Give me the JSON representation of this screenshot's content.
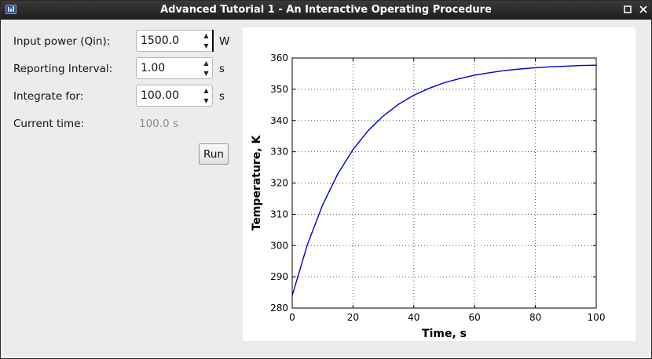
{
  "window": {
    "title": "Advanced Tutorial 1 - An Interactive Operating Procedure"
  },
  "icons": {
    "app": "app-logo-icon",
    "maximize": "maximize-icon",
    "close": "close-icon",
    "spin_up": "triangle-up-icon",
    "spin_down": "triangle-down-icon"
  },
  "form": {
    "input_power": {
      "label": "Input power (Qin):",
      "value": "1500.0",
      "unit": "W"
    },
    "reporting_interval": {
      "label": "Reporting Interval:",
      "value": "1.00",
      "unit": "s"
    },
    "integrate_for": {
      "label": "Integrate for:",
      "value": "100.00",
      "unit": "s"
    },
    "current_time": {
      "label": "Current time:",
      "value": "100.0 s"
    },
    "run_label": "Run"
  },
  "chart_data": {
    "type": "line",
    "title": "",
    "xlabel": "Time, s",
    "ylabel": "Temperature, K",
    "xlim": [
      0,
      100
    ],
    "ylim": [
      280,
      360
    ],
    "xticks": [
      0,
      20,
      40,
      60,
      80,
      100
    ],
    "yticks": [
      280,
      290,
      300,
      310,
      320,
      330,
      340,
      350,
      360
    ],
    "grid": true,
    "series": [
      {
        "color": "#0000cc",
        "x": [
          0,
          5,
          10,
          15,
          20,
          25,
          30,
          35,
          40,
          45,
          50,
          55,
          60,
          65,
          70,
          75,
          80,
          85,
          90,
          95,
          100
        ],
        "y": [
          284,
          300.3,
          313.0,
          322.9,
          330.7,
          336.8,
          341.5,
          345.2,
          348.1,
          350.3,
          352.1,
          353.4,
          354.5,
          355.3,
          356.0,
          356.5,
          356.9,
          357.2,
          357.4,
          357.6,
          357.7
        ]
      }
    ]
  }
}
